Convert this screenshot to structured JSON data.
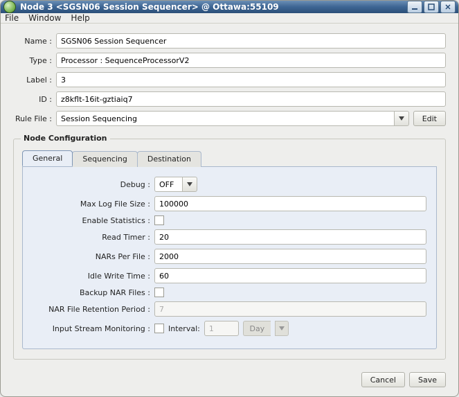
{
  "window": {
    "title": "Node 3 <SGSN06 Session Sequencer> @ Ottawa:55109"
  },
  "menubar": {
    "file": "File",
    "window": "Window",
    "help": "Help"
  },
  "form": {
    "name_label": "Name :",
    "name_value": "SGSN06 Session Sequencer",
    "type_label": "Type :",
    "type_value": "Processor : SequenceProcessorV2",
    "label_label": "Label :",
    "label_value": "3",
    "id_label": "ID :",
    "id_value": "z8kflt-16it-gztiaiq7",
    "rulefile_label": "Rule File :",
    "rulefile_value": "Session Sequencing",
    "edit_button": "Edit"
  },
  "fieldset": {
    "legend": "Node Configuration"
  },
  "tabs": {
    "general": "General",
    "sequencing": "Sequencing",
    "destination": "Destination"
  },
  "config": {
    "debug_label": "Debug :",
    "debug_value": "OFF",
    "maxlog_label": "Max Log File Size :",
    "maxlog_value": "100000",
    "stats_label": "Enable Statistics :",
    "readtimer_label": "Read Timer :",
    "readtimer_value": "20",
    "nars_label": "NARs Per File :",
    "nars_value": "2000",
    "idle_label": "Idle Write Time :",
    "idle_value": "60",
    "backup_label": "Backup NAR Files :",
    "retention_label": "NAR File Retention Period :",
    "retention_value": "7",
    "monitor_label": "Input Stream Monitoring :",
    "interval_label": "Interval:",
    "interval_value": "1",
    "interval_unit": "Day"
  },
  "footer": {
    "cancel": "Cancel",
    "save": "Save"
  }
}
